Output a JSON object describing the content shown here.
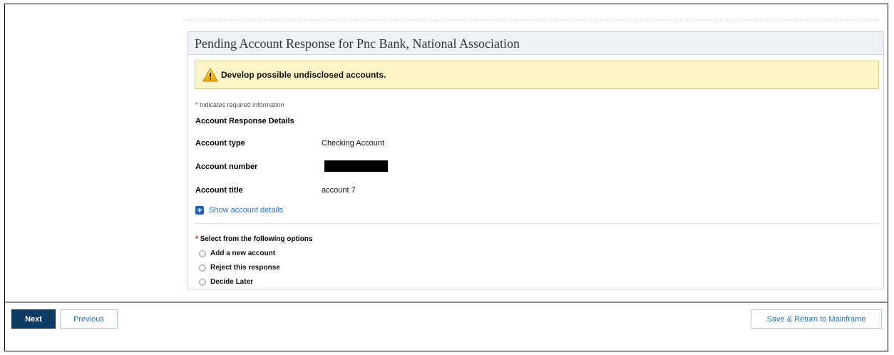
{
  "panel": {
    "title": "Pending Account Response for Pnc Bank, National Association"
  },
  "alert": {
    "icon": "warning-icon",
    "text": "Develop possible undisclosed accounts."
  },
  "form": {
    "required_star": "*",
    "required_note": "Indicates required information",
    "section_title": "Account Response Details",
    "fields": {
      "account_type": {
        "label": "Account type",
        "value": "Checking Account"
      },
      "account_number": {
        "label": "Account number",
        "value_redacted": true
      },
      "account_title": {
        "label": "Account title",
        "value": "account 7"
      }
    },
    "show_details": {
      "icon": "plus-icon",
      "label": "Show account details"
    },
    "options_title": "Select from the following options",
    "options": [
      {
        "label": "Add a new account",
        "selected": false
      },
      {
        "label": "Reject this response",
        "selected": false
      },
      {
        "label": "Decide Later",
        "selected": false
      }
    ]
  },
  "footer": {
    "next_label": "Next",
    "previous_label": "Previous",
    "save_label": "Save & Return to Mainframe"
  },
  "colors": {
    "primary_button": "#0d3b64",
    "link": "#1f6fbf",
    "alert_background": "#fdf5c8",
    "required": "#d0021b"
  }
}
